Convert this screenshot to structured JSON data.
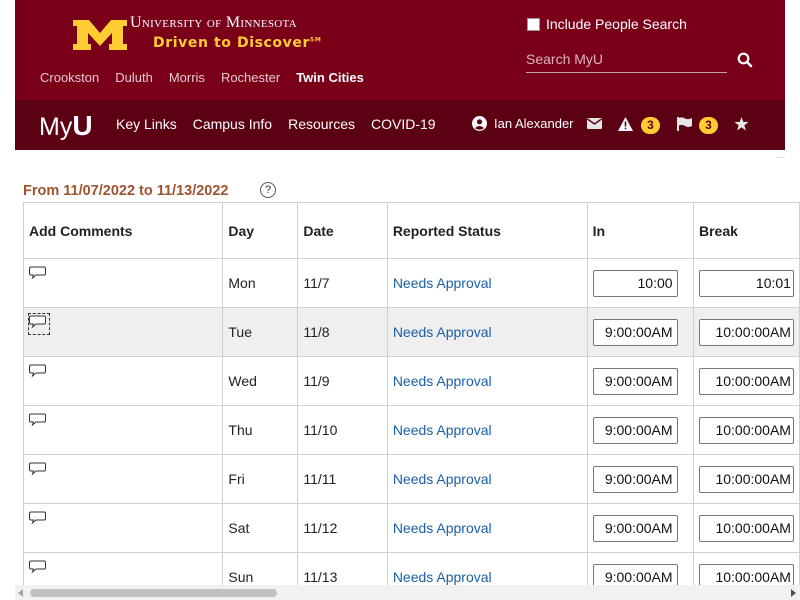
{
  "header": {
    "university": "University of Minnesota",
    "tagline": "Driven to Discover",
    "tagline_mark": "SM",
    "campuses": [
      "Crookston",
      "Duluth",
      "Morris",
      "Rochester",
      "Twin Cities"
    ],
    "active_campus": "Twin Cities",
    "include_people_label": "Include People Search",
    "include_people_checked": false,
    "search_placeholder": "Search MyU",
    "search_value": ""
  },
  "nav": {
    "logo_prefix": "My",
    "logo_suffix": "U",
    "items": [
      "Key Links",
      "Campus Info",
      "Resources",
      "COVID-19"
    ],
    "user_name": "Ian Alexander",
    "alerts_count": "3",
    "flags_count": "3",
    "icons": [
      "user-circle-icon",
      "envelope-icon",
      "warning-icon",
      "flag-icon",
      "star-icon"
    ]
  },
  "timesheet": {
    "range_from_label": "From",
    "range_start": "11/07/2022",
    "range_to_label": "to",
    "range_end": "11/13/2022",
    "help_symbol": "?",
    "columns": [
      "Add Comments",
      "Day",
      "Date",
      "Reported Status",
      "In",
      "Break"
    ],
    "rows": [
      {
        "day": "Mon",
        "date": "11/7",
        "status": "Needs Approval",
        "in": "10:00",
        "break": "10:01"
      },
      {
        "day": "Tue",
        "date": "11/8",
        "status": "Needs Approval",
        "in": "9:00:00AM",
        "break": "10:00:00AM"
      },
      {
        "day": "Wed",
        "date": "11/9",
        "status": "Needs Approval",
        "in": "9:00:00AM",
        "break": "10:00:00AM"
      },
      {
        "day": "Thu",
        "date": "11/10",
        "status": "Needs Approval",
        "in": "9:00:00AM",
        "break": "10:00:00AM"
      },
      {
        "day": "Fri",
        "date": "11/11",
        "status": "Needs Approval",
        "in": "9:00:00AM",
        "break": "10:00:00AM"
      },
      {
        "day": "Sat",
        "date": "11/12",
        "status": "Needs Approval",
        "in": "9:00:00AM",
        "break": "10:00:00AM"
      },
      {
        "day": "Sun",
        "date": "11/13",
        "status": "Needs Approval",
        "in": "9:00:00AM",
        "break": "10:00:00AM"
      }
    ]
  },
  "colors": {
    "maroon": "#7a0019",
    "nav_maroon": "#5c0013",
    "gold": "#ffcc33",
    "range_text": "#a0522d",
    "link_blue": "#1a5fa8"
  }
}
